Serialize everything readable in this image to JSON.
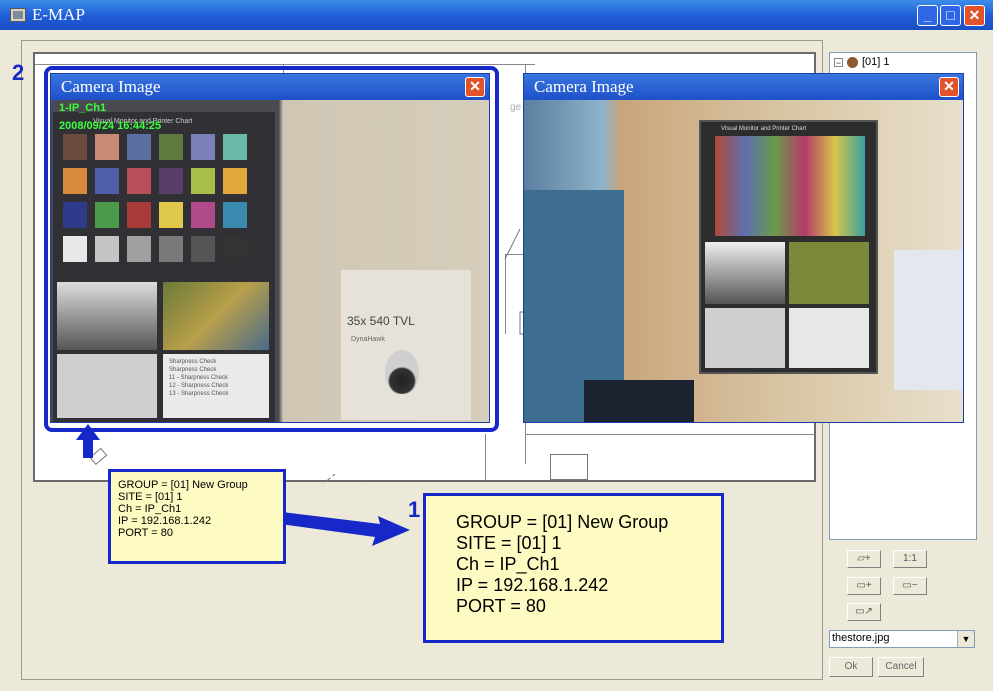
{
  "window": {
    "title": "E-MAP"
  },
  "annotations": {
    "num1": "1",
    "num2": "2"
  },
  "tree": {
    "node_label": "[01] 1",
    "expand_symbol": "⊟"
  },
  "map": {
    "partial_text": "ge"
  },
  "camera_left": {
    "title": "Camera Image",
    "channel": "1-IP_Ch1",
    "timestamp": "2008/09/24  16:44:25",
    "chart_heading": "Visual Monitor and Printer Chart",
    "poster_text": "35x  540 TVL",
    "poster_brand": "DynaHawk",
    "chart_list": [
      "Sharpness Check",
      "Sharpness Check",
      "11 - Sharpness Check",
      "12 - Sharpness Check",
      "13 - Sharpness Check"
    ]
  },
  "camera_right": {
    "title": "Camera Image",
    "chart_heading": "Visual Monitor and Printer Chart"
  },
  "info_small": {
    "lines": [
      "GROUP = [01] New Group",
      "SITE = [01] 1",
      "Ch = IP_Ch1",
      "IP = 192.168.1.242",
      "PORT = 80"
    ]
  },
  "info_large": {
    "lines": [
      "GROUP = [01] New Group",
      "SITE = [01] 1",
      "Ch = IP_Ch1",
      "IP = 192.168.1.242",
      "PORT = 80"
    ]
  },
  "panel": {
    "map_file": "thestore.jpg",
    "ok_label": "Ok",
    "cancel_label": "Cancel"
  },
  "colors": {
    "accent": "#1628c8",
    "info_bg": "#fdfbc2",
    "osd": "#3cff3c"
  }
}
